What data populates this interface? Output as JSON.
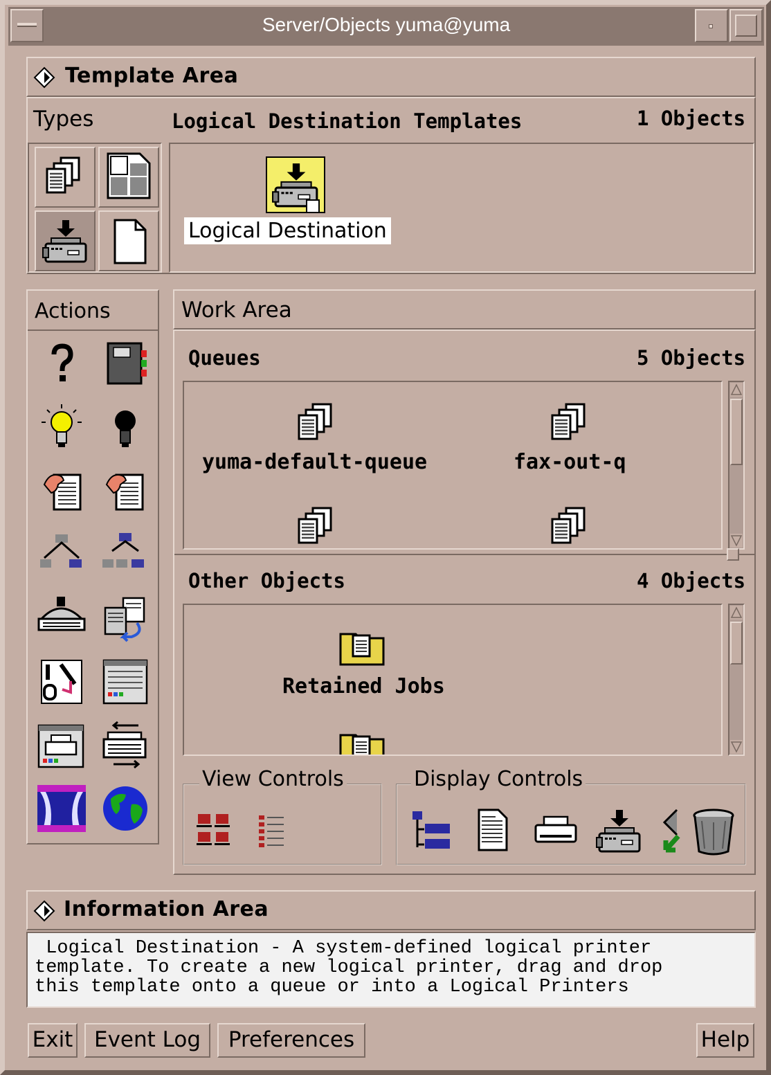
{
  "window": {
    "title": "Server/Objects yuma@yuma"
  },
  "template_area": {
    "title": "Template Area",
    "types_label": "Types",
    "section_title": "Logical Destination Templates",
    "count": "1 Objects",
    "item_label": "Logical Destination"
  },
  "actions": {
    "title": "Actions"
  },
  "work_area": {
    "title": "Work Area",
    "queues": {
      "title": "Queues",
      "count": "5 Objects",
      "items": [
        "yuma-default-queue",
        "fax-out-q"
      ]
    },
    "other": {
      "title": "Other Objects",
      "count": "4 Objects",
      "items": [
        "Retained Jobs"
      ]
    },
    "view_controls": "View Controls",
    "display_controls": "Display Controls"
  },
  "info_area": {
    "title": "Information Area",
    "text": " Logical Destination - A system-defined logical printer\ntemplate. To create a new logical printer, drag and drop\nthis template onto a queue or into a Logical Printers"
  },
  "buttons": {
    "exit": "Exit",
    "event_log": "Event Log",
    "preferences": "Preferences",
    "help": "Help"
  },
  "colors": {
    "background": "#c4aea4",
    "titlebar": "#8a7870",
    "selected_icon": "#f4ee6a",
    "text_bg": "#f2f2f2"
  }
}
